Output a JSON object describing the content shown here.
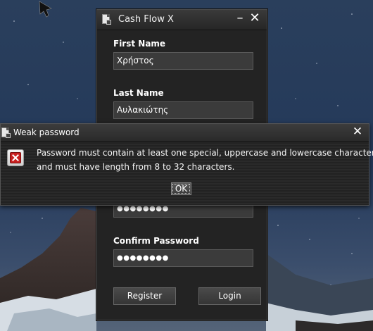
{
  "main_window": {
    "title": "Cash Flow X",
    "minimize_symbol": "–",
    "close_symbol": "✕",
    "first_name_label": "First Name",
    "first_name_value": "Χρήστος",
    "last_name_label": "Last Name",
    "last_name_value": "Αυλακιώτης",
    "password_masked": "●●●●●●●●",
    "confirm_password_label": "Confirm Password",
    "confirm_password_masked": "●●●●●●●●",
    "register_label": "Register",
    "login_label": "Login"
  },
  "dialog": {
    "title": "Weak password",
    "close_symbol": "✕",
    "message_line1": "Password must contain at least one special, uppercase and lowercase character",
    "message_line2": "and must have length from 8 to 32 characters.",
    "ok_label": "OK",
    "icon": "error-icon"
  },
  "colors": {
    "window_bg": "#232323",
    "error_red": "#c82020"
  }
}
